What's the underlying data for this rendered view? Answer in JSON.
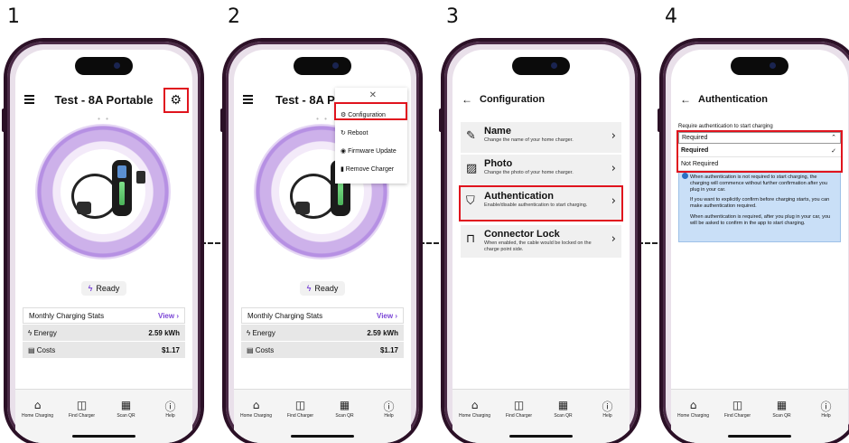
{
  "steps": [
    "1",
    "2",
    "3",
    "4"
  ],
  "device": {
    "title": "Test - 8A Portable",
    "title_truncated": "Test - 8A Po",
    "status": "Ready",
    "stats": {
      "header": "Monthly Charging Stats",
      "view_label": "View",
      "energy_label": "Energy",
      "energy_value": "2.59 kWh",
      "costs_label": "Costs",
      "costs_value": "$1.17"
    }
  },
  "menu": {
    "items": [
      "Configuration",
      "Reboot",
      "Firmware Update",
      "Remove Charger"
    ]
  },
  "configuration": {
    "title": "Configuration",
    "items": [
      {
        "name": "Name",
        "desc": "Change the name of your home charger."
      },
      {
        "name": "Photo",
        "desc": "Change the photo of your home charger."
      },
      {
        "name": "Authentication",
        "desc": "Enable/disable authentication to start charging."
      },
      {
        "name": "Connector Lock",
        "desc": "When enabled, the cable would be locked on the charge point side."
      }
    ]
  },
  "authentication": {
    "title": "Authentication",
    "label": "Require authentication to start charging",
    "selected": "Required",
    "options": [
      "Required",
      "Not Required"
    ],
    "info": [
      "When authentication is not required to start charging, the charging will commence without further confirmation after you plug in your car.",
      "If you want to explicitly confirm before charging starts, you can make authentication required.",
      "When authentication is required, after you plug in your car, you will be asked to confirm in the app to start charging."
    ]
  },
  "nav": [
    "Home Charging",
    "Find Charger",
    "Scan QR",
    "Help"
  ],
  "colors": {
    "accent": "#7b46d6",
    "highlight": "#e0141e",
    "info_bg": "#c9dff7"
  }
}
